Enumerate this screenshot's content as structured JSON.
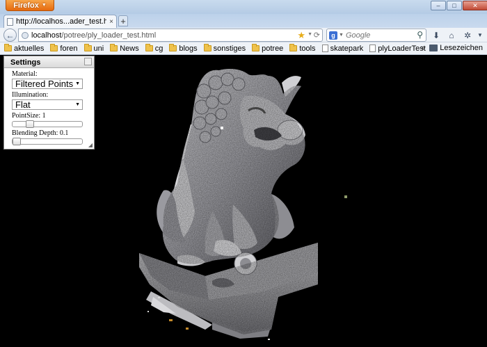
{
  "window": {
    "app_button_label": "Firefox",
    "controls": {
      "minimize": "–",
      "maximize": "□",
      "close": "✕"
    }
  },
  "tabs": [
    {
      "title": "http://localhos...ader_test.html",
      "close": "×"
    }
  ],
  "new_tab_label": "+",
  "address": {
    "host": "localhost",
    "path": "/potree/ply_loader_test.html"
  },
  "search": {
    "engine": "g",
    "placeholder": "Google"
  },
  "bookmarks": [
    {
      "label": "aktuelles",
      "icon": "folder-icon"
    },
    {
      "label": "foren",
      "icon": "folder-icon"
    },
    {
      "label": "uni",
      "icon": "folder-icon"
    },
    {
      "label": "News",
      "icon": "folder-icon"
    },
    {
      "label": "cg",
      "icon": "folder-icon"
    },
    {
      "label": "blogs",
      "icon": "folder-icon"
    },
    {
      "label": "sonstiges",
      "icon": "folder-icon"
    },
    {
      "label": "potree",
      "icon": "folder-icon"
    },
    {
      "label": "tools",
      "icon": "folder-icon"
    },
    {
      "label": "skatepark",
      "icon": "page-icon"
    },
    {
      "label": "plyLoaderTest",
      "icon": "page-icon"
    }
  ],
  "bookmarks_overflow": "»",
  "library_label": "Lesezeichen",
  "settings": {
    "title": "Settings",
    "material_label": "Material:",
    "material_value": "Filtered Points",
    "illumination_label": "Illumination:",
    "illumination_value": "Flat",
    "pointsize_label": "PointSize: 1",
    "pointsize_fraction": 0.22,
    "blending_label": "Blending Depth: 0.1",
    "blending_fraction": 0.0
  },
  "colors": {
    "viewport_background": "#000000",
    "firefox_orange": "#e66a0e",
    "statue_light": "#cfcfd2",
    "statue_dark": "#4d4d52"
  }
}
